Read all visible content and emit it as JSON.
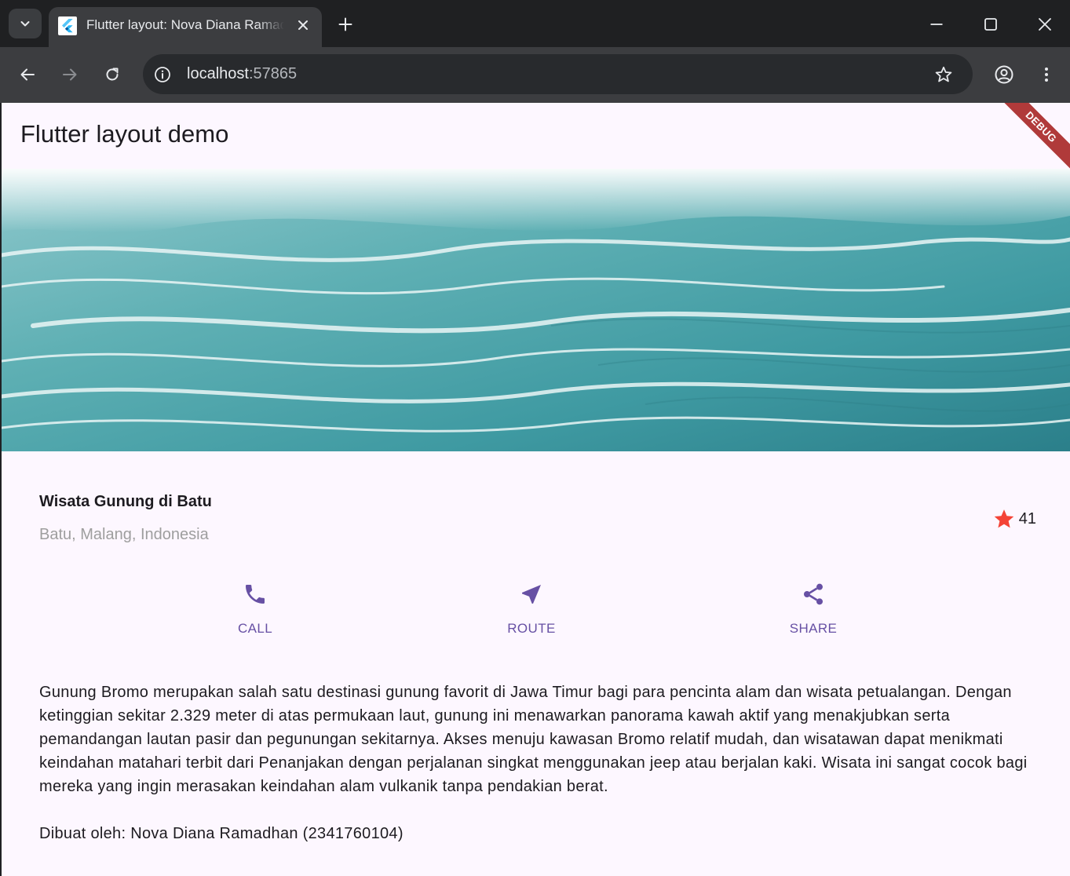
{
  "browser": {
    "tab": {
      "title": "Flutter layout: Nova Diana Ramadhan"
    },
    "url": {
      "host": "localhost",
      "port": ":57865"
    }
  },
  "app": {
    "title": "Flutter layout demo",
    "debug_banner": "DEBUG",
    "place": {
      "name": "Wisata Gunung di Batu",
      "location": "Batu, Malang, Indonesia",
      "rating_count": "41"
    },
    "actions": [
      {
        "label": "CALL",
        "icon": "phone-icon"
      },
      {
        "label": "ROUTE",
        "icon": "near-me-icon"
      },
      {
        "label": "SHARE",
        "icon": "share-icon"
      }
    ],
    "description": "Gunung Bromo merupakan salah satu destinasi gunung favorit di Jawa Timur bagi para pencinta alam dan wisata petualangan. Dengan ketinggian sekitar 2.329 meter di atas permukaan laut, gunung ini menawarkan panorama kawah aktif yang menakjubkan serta pemandangan lautan pasir dan pegunungan sekitarnya. Akses menuju kawasan Bromo relatif mudah, dan wisatawan dapat menikmati keindahan matahari terbit dari Penanjakan dengan perjalanan singkat menggunakan jeep atau berjalan kaki. Wisata ini sangat cocok bagi mereka yang ingin merasakan keindahan alam vulkanik tanpa pendakian berat.",
    "credit": "Dibuat oleh: Nova Diana Ramadhan (2341760104)"
  },
  "colors": {
    "accent": "#6750a4",
    "star": "#f44336",
    "page_bg": "#fdf7ff",
    "subtitle": "#9e9e9e"
  }
}
